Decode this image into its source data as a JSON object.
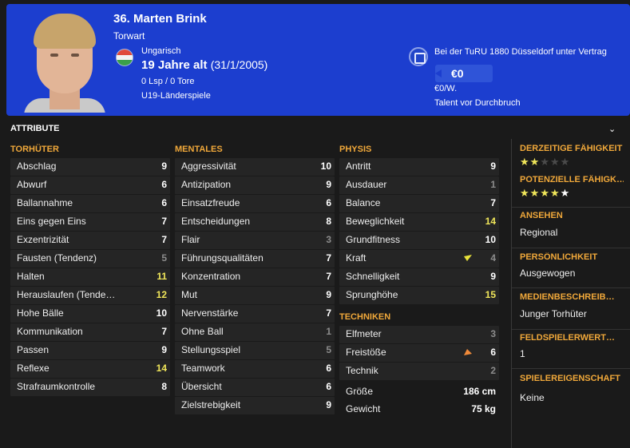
{
  "header": {
    "name": "36. Marten Brink",
    "position": "Torwart",
    "nationality": "Ungarisch",
    "age": "19 Jahre alt",
    "dob": "(31/1/2005)",
    "caps": "0 Lsp / 0 Tore",
    "youth": "U19-Länderspiele",
    "contract": "Bei der TuRU 1880 Düsseldorf unter Vertrag",
    "value": "€0",
    "wage": "€0/W.",
    "talent": "Talent vor Durchbruch"
  },
  "attributes": {
    "title": "ATTRIBUTE",
    "goalkeeping": {
      "heading": "TORHÜTER",
      "items": [
        {
          "label": "Abschlag",
          "value": "9"
        },
        {
          "label": "Abwurf",
          "value": "6"
        },
        {
          "label": "Ballannahme",
          "value": "6"
        },
        {
          "label": "Eins gegen Eins",
          "value": "7"
        },
        {
          "label": "Exzentrizität",
          "value": "7"
        },
        {
          "label": "Fausten (Tendenz)",
          "value": "5"
        },
        {
          "label": "Halten",
          "value": "11"
        },
        {
          "label": "Herauslaufen (Tende…",
          "value": "12"
        },
        {
          "label": "Hohe Bälle",
          "value": "10"
        },
        {
          "label": "Kommunikation",
          "value": "7"
        },
        {
          "label": "Passen",
          "value": "9"
        },
        {
          "label": "Reflexe",
          "value": "14"
        },
        {
          "label": "Strafraumkontrolle",
          "value": "8"
        }
      ]
    },
    "mental": {
      "heading": "MENTALES",
      "items": [
        {
          "label": "Aggressivität",
          "value": "10"
        },
        {
          "label": "Antizipation",
          "value": "9"
        },
        {
          "label": "Einsatzfreude",
          "value": "6"
        },
        {
          "label": "Entscheidungen",
          "value": "8"
        },
        {
          "label": "Flair",
          "value": "3"
        },
        {
          "label": "Führungsqualitäten",
          "value": "7"
        },
        {
          "label": "Konzentration",
          "value": "7"
        },
        {
          "label": "Mut",
          "value": "9"
        },
        {
          "label": "Nervenstärke",
          "value": "7"
        },
        {
          "label": "Ohne Ball",
          "value": "1"
        },
        {
          "label": "Stellungsspiel",
          "value": "5"
        },
        {
          "label": "Teamwork",
          "value": "6"
        },
        {
          "label": "Übersicht",
          "value": "6"
        },
        {
          "label": "Zielstrebigkeit",
          "value": "9"
        }
      ]
    },
    "physical": {
      "heading": "PHYSIS",
      "items": [
        {
          "label": "Antritt",
          "value": "9"
        },
        {
          "label": "Ausdauer",
          "value": "1"
        },
        {
          "label": "Balance",
          "value": "7"
        },
        {
          "label": "Beweglichkeit",
          "value": "14"
        },
        {
          "label": "Grundfitness",
          "value": "10"
        },
        {
          "label": "Kraft",
          "value": "4"
        },
        {
          "label": "Schnelligkeit",
          "value": "9"
        },
        {
          "label": "Sprunghöhe",
          "value": "15"
        }
      ]
    },
    "technical": {
      "heading": "TECHNIKEN",
      "items": [
        {
          "label": "Elfmeter",
          "value": "3"
        },
        {
          "label": "Freistöße",
          "value": "6"
        },
        {
          "label": "Technik",
          "value": "2"
        }
      ]
    },
    "body": {
      "height_label": "Größe",
      "height_value": "186 cm",
      "weight_label": "Gewicht",
      "weight_value": "75 kg"
    }
  },
  "side": {
    "current_ability_heading": "DERZEITIGE FÄHIGKEIT",
    "current_ability_stars": 2,
    "potential_ability_heading": "POTENZIELLE FÄHIGK…",
    "potential_ability_stars": 4.5,
    "reputation_heading": "ANSEHEN",
    "reputation_value": "Regional",
    "personality_heading": "PERSÖNLICHKEIT",
    "personality_value": "Ausgewogen",
    "media_heading": "MEDIENBESCHREIB…",
    "media_value": "Junger Torhüter",
    "outfield_heading": "FELDSPIELERWERT…",
    "outfield_value": "1",
    "traits_heading": "SPIELEREIGENSCHAFT",
    "traits_value": "Keine"
  },
  "colors": {
    "header_bg": "#1c3ecf",
    "accent": "#f0a83a",
    "highlight": "#f0e65a"
  }
}
